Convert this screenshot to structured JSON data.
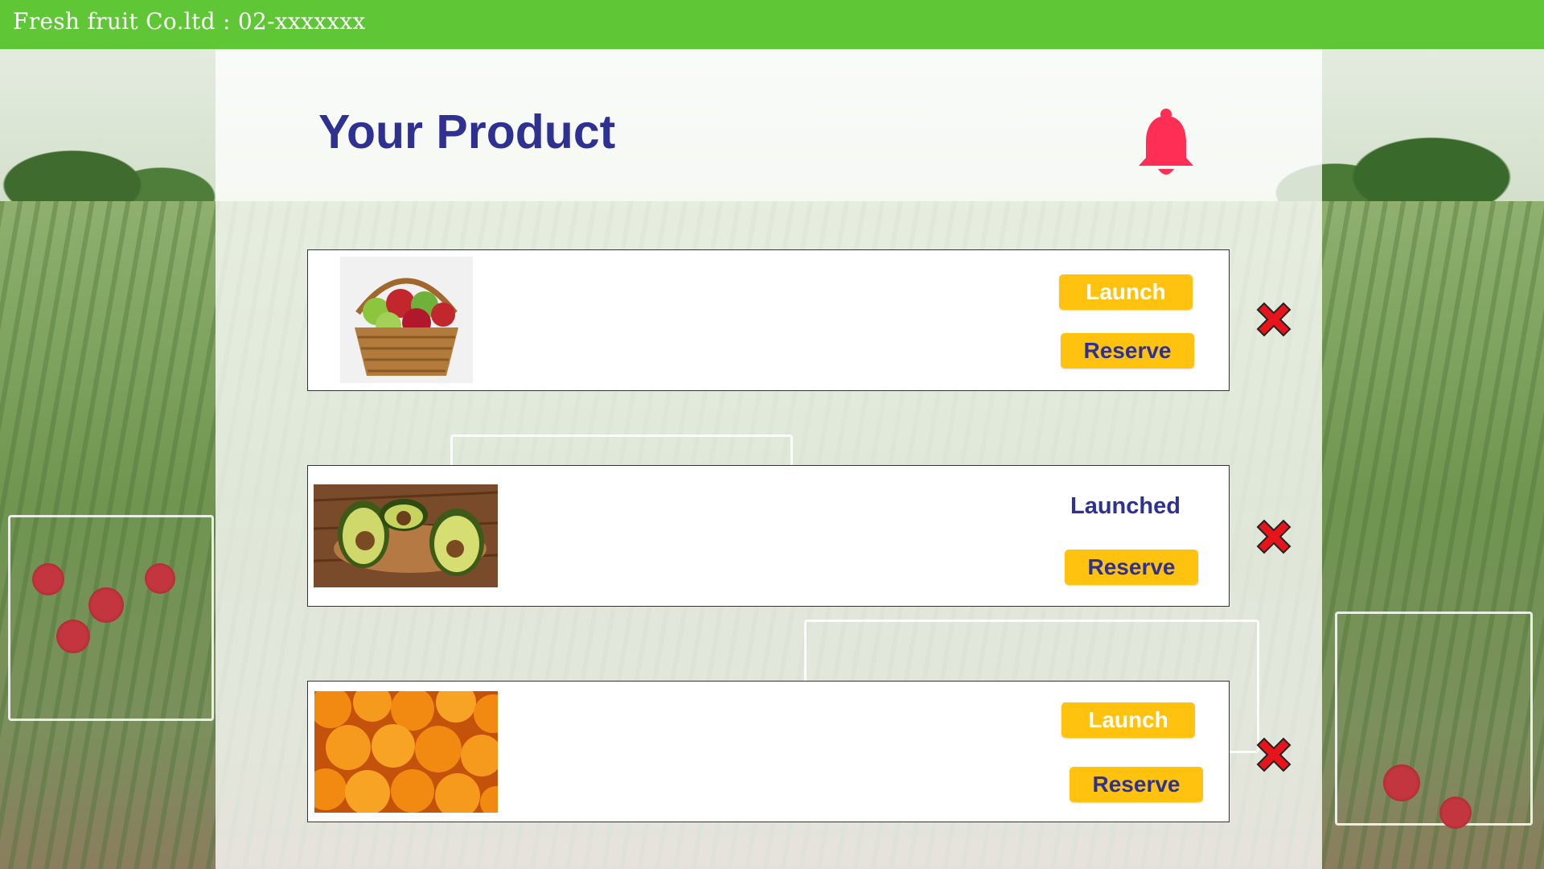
{
  "header": {
    "company": "Fresh fruit Co.ltd : 02-xxxxxxx"
  },
  "page": {
    "title": "Your Product"
  },
  "icons": {
    "notification": "bell-icon",
    "delete": "close-x-icon"
  },
  "colors": {
    "header_bg": "#5fc636",
    "title": "#2e3192",
    "button_bg": "#ffc20e",
    "bell": "#ff2e55",
    "delete": "#e8141b"
  },
  "products": [
    {
      "image": "apple-basket-image",
      "launch_label": "Launch",
      "reserve_label": "Reserve"
    },
    {
      "image": "avocado-image",
      "status": "Launched",
      "reserve_label": "Reserve"
    },
    {
      "image": "oranges-image",
      "launch_label": "Launch",
      "reserve_label": "Reserve"
    }
  ]
}
